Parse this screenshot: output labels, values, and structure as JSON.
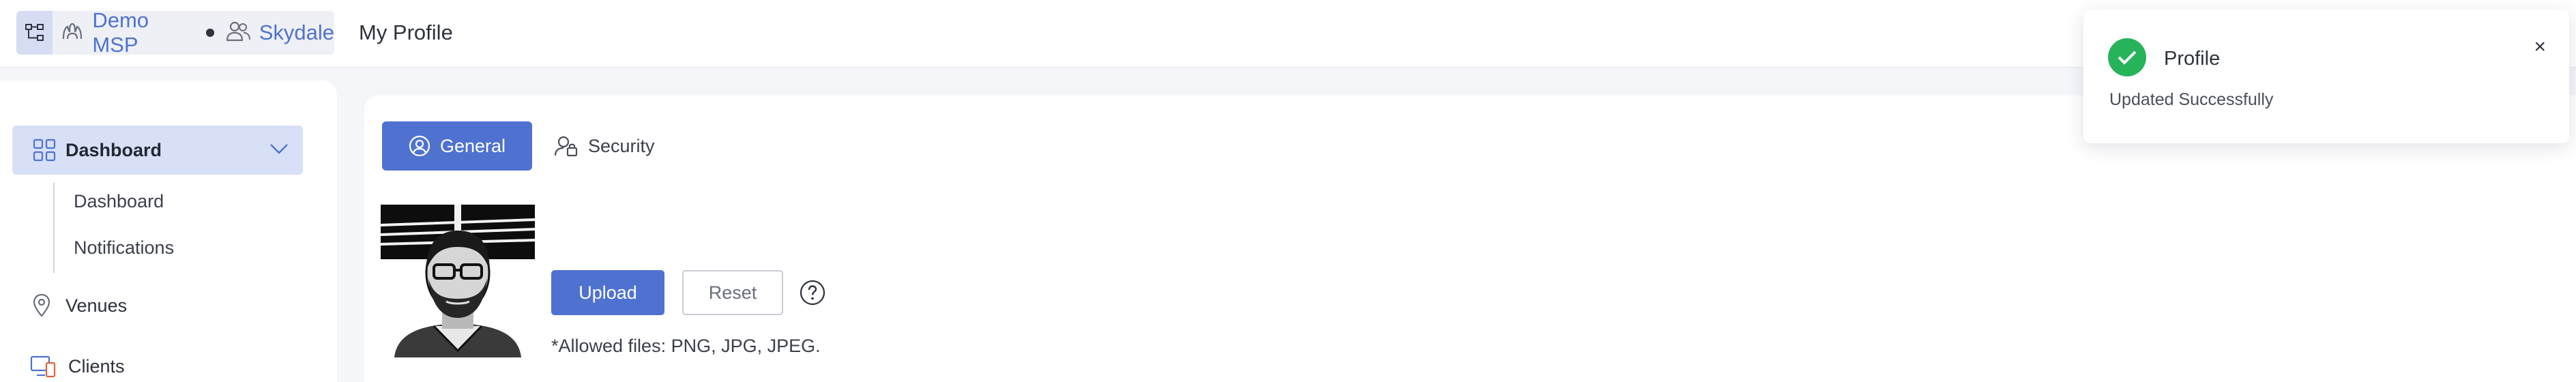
{
  "header": {
    "msp_name": "Demo MSP",
    "org_name": "Skydale",
    "page_title": "My Profile"
  },
  "sidebar": {
    "items": [
      {
        "label": "Dashboard",
        "icon": "grid-icon",
        "expanded": true,
        "children": [
          "Dashboard",
          "Notifications"
        ]
      },
      {
        "label": "Venues",
        "icon": "map-pin-icon"
      },
      {
        "label": "Clients",
        "icon": "devices-icon"
      }
    ]
  },
  "main": {
    "tabs": [
      {
        "label": "General",
        "icon": "user-circle-icon",
        "active": true
      },
      {
        "label": "Security",
        "icon": "user-lock-icon",
        "active": false
      }
    ],
    "upload_label": "Upload",
    "reset_label": "Reset",
    "allowed_files": "*Allowed files: PNG, JPG, JPEG."
  },
  "toast": {
    "title": "Profile",
    "message": "Updated Successfully",
    "status": "success",
    "close_symbol": "×"
  },
  "colors": {
    "accent": "#4f72d1",
    "success": "#27b35a",
    "nav_active_bg": "#d7e0f7"
  }
}
